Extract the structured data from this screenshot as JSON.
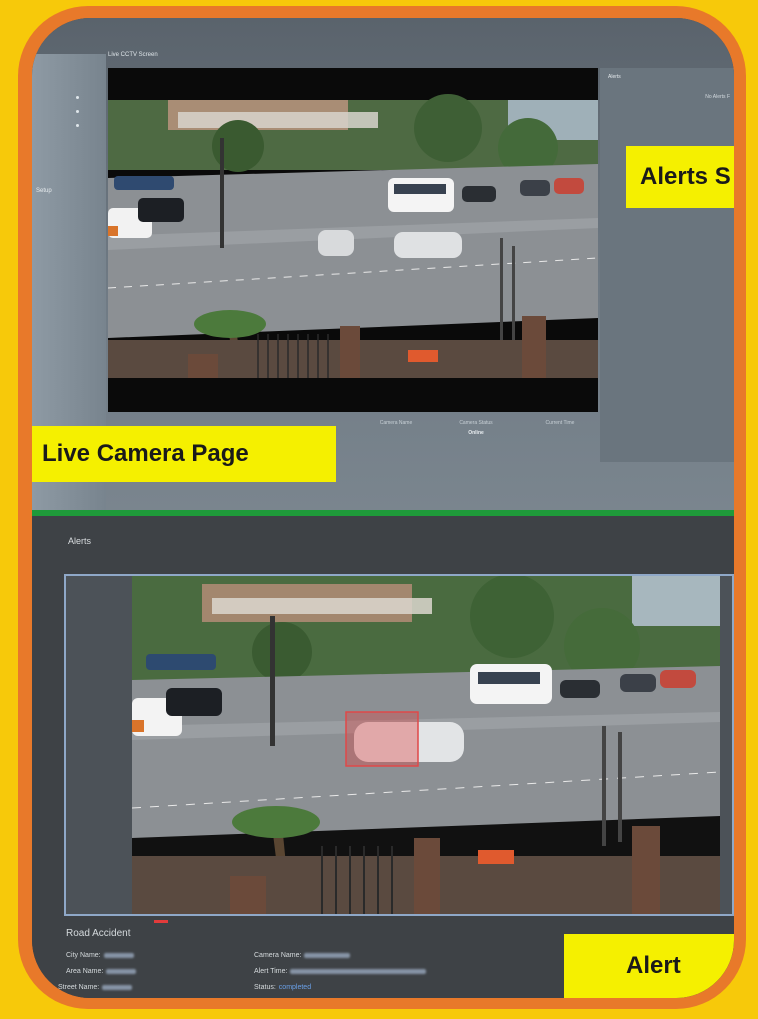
{
  "live_page": {
    "screen_title": "Live CCTV Screen",
    "sidebar_items": [
      "",
      "Setup"
    ],
    "info": [
      {
        "label": "Camera Name",
        "value": ""
      },
      {
        "label": "Camera Status",
        "value": "Online"
      },
      {
        "label": "Current Time",
        "value": ""
      }
    ],
    "alerts_header": "Alerts",
    "no_alerts": "No Alerts F",
    "label": "Live Camera Page",
    "alerts_label": "Alerts S"
  },
  "alert_page": {
    "title": "Alerts",
    "event": "Road Accident",
    "fields_left": [
      {
        "key": "City Name:",
        "value": ""
      },
      {
        "key": "Area Name:",
        "value": ""
      },
      {
        "key": "Street Name:",
        "value": ""
      }
    ],
    "fields_right": [
      {
        "key": "Camera Name:",
        "value": ""
      },
      {
        "key": "Alert Time:",
        "value": ""
      },
      {
        "key": "Status:",
        "value": "completed"
      }
    ],
    "label": "Alert"
  },
  "colors": {
    "background": "#f7c90a",
    "frame": "#e8792a",
    "label": "#f5f000",
    "divider": "#1f9a3a",
    "detection_box": "#e04848"
  }
}
